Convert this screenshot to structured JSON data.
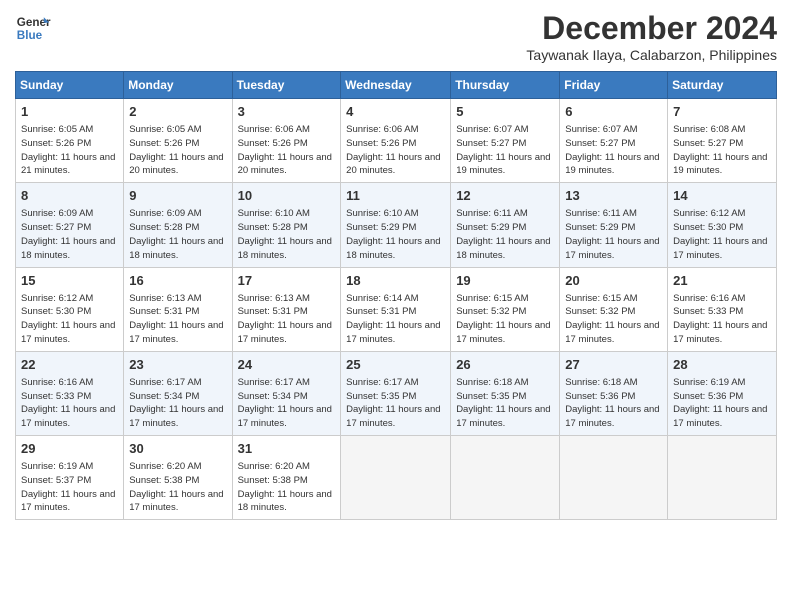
{
  "logo": {
    "line1": "General",
    "line2": "Blue"
  },
  "title": "December 2024",
  "subtitle": "Taywanak Ilaya, Calabarzon, Philippines",
  "headers": [
    "Sunday",
    "Monday",
    "Tuesday",
    "Wednesday",
    "Thursday",
    "Friday",
    "Saturday"
  ],
  "weeks": [
    [
      {
        "day": "1",
        "sunrise": "Sunrise: 6:05 AM",
        "sunset": "Sunset: 5:26 PM",
        "daylight": "Daylight: 11 hours and 21 minutes."
      },
      {
        "day": "2",
        "sunrise": "Sunrise: 6:05 AM",
        "sunset": "Sunset: 5:26 PM",
        "daylight": "Daylight: 11 hours and 20 minutes."
      },
      {
        "day": "3",
        "sunrise": "Sunrise: 6:06 AM",
        "sunset": "Sunset: 5:26 PM",
        "daylight": "Daylight: 11 hours and 20 minutes."
      },
      {
        "day": "4",
        "sunrise": "Sunrise: 6:06 AM",
        "sunset": "Sunset: 5:26 PM",
        "daylight": "Daylight: 11 hours and 20 minutes."
      },
      {
        "day": "5",
        "sunrise": "Sunrise: 6:07 AM",
        "sunset": "Sunset: 5:27 PM",
        "daylight": "Daylight: 11 hours and 19 minutes."
      },
      {
        "day": "6",
        "sunrise": "Sunrise: 6:07 AM",
        "sunset": "Sunset: 5:27 PM",
        "daylight": "Daylight: 11 hours and 19 minutes."
      },
      {
        "day": "7",
        "sunrise": "Sunrise: 6:08 AM",
        "sunset": "Sunset: 5:27 PM",
        "daylight": "Daylight: 11 hours and 19 minutes."
      }
    ],
    [
      {
        "day": "8",
        "sunrise": "Sunrise: 6:09 AM",
        "sunset": "Sunset: 5:27 PM",
        "daylight": "Daylight: 11 hours and 18 minutes."
      },
      {
        "day": "9",
        "sunrise": "Sunrise: 6:09 AM",
        "sunset": "Sunset: 5:28 PM",
        "daylight": "Daylight: 11 hours and 18 minutes."
      },
      {
        "day": "10",
        "sunrise": "Sunrise: 6:10 AM",
        "sunset": "Sunset: 5:28 PM",
        "daylight": "Daylight: 11 hours and 18 minutes."
      },
      {
        "day": "11",
        "sunrise": "Sunrise: 6:10 AM",
        "sunset": "Sunset: 5:29 PM",
        "daylight": "Daylight: 11 hours and 18 minutes."
      },
      {
        "day": "12",
        "sunrise": "Sunrise: 6:11 AM",
        "sunset": "Sunset: 5:29 PM",
        "daylight": "Daylight: 11 hours and 18 minutes."
      },
      {
        "day": "13",
        "sunrise": "Sunrise: 6:11 AM",
        "sunset": "Sunset: 5:29 PM",
        "daylight": "Daylight: 11 hours and 17 minutes."
      },
      {
        "day": "14",
        "sunrise": "Sunrise: 6:12 AM",
        "sunset": "Sunset: 5:30 PM",
        "daylight": "Daylight: 11 hours and 17 minutes."
      }
    ],
    [
      {
        "day": "15",
        "sunrise": "Sunrise: 6:12 AM",
        "sunset": "Sunset: 5:30 PM",
        "daylight": "Daylight: 11 hours and 17 minutes."
      },
      {
        "day": "16",
        "sunrise": "Sunrise: 6:13 AM",
        "sunset": "Sunset: 5:31 PM",
        "daylight": "Daylight: 11 hours and 17 minutes."
      },
      {
        "day": "17",
        "sunrise": "Sunrise: 6:13 AM",
        "sunset": "Sunset: 5:31 PM",
        "daylight": "Daylight: 11 hours and 17 minutes."
      },
      {
        "day": "18",
        "sunrise": "Sunrise: 6:14 AM",
        "sunset": "Sunset: 5:31 PM",
        "daylight": "Daylight: 11 hours and 17 minutes."
      },
      {
        "day": "19",
        "sunrise": "Sunrise: 6:15 AM",
        "sunset": "Sunset: 5:32 PM",
        "daylight": "Daylight: 11 hours and 17 minutes."
      },
      {
        "day": "20",
        "sunrise": "Sunrise: 6:15 AM",
        "sunset": "Sunset: 5:32 PM",
        "daylight": "Daylight: 11 hours and 17 minutes."
      },
      {
        "day": "21",
        "sunrise": "Sunrise: 6:16 AM",
        "sunset": "Sunset: 5:33 PM",
        "daylight": "Daylight: 11 hours and 17 minutes."
      }
    ],
    [
      {
        "day": "22",
        "sunrise": "Sunrise: 6:16 AM",
        "sunset": "Sunset: 5:33 PM",
        "daylight": "Daylight: 11 hours and 17 minutes."
      },
      {
        "day": "23",
        "sunrise": "Sunrise: 6:17 AM",
        "sunset": "Sunset: 5:34 PM",
        "daylight": "Daylight: 11 hours and 17 minutes."
      },
      {
        "day": "24",
        "sunrise": "Sunrise: 6:17 AM",
        "sunset": "Sunset: 5:34 PM",
        "daylight": "Daylight: 11 hours and 17 minutes."
      },
      {
        "day": "25",
        "sunrise": "Sunrise: 6:17 AM",
        "sunset": "Sunset: 5:35 PM",
        "daylight": "Daylight: 11 hours and 17 minutes."
      },
      {
        "day": "26",
        "sunrise": "Sunrise: 6:18 AM",
        "sunset": "Sunset: 5:35 PM",
        "daylight": "Daylight: 11 hours and 17 minutes."
      },
      {
        "day": "27",
        "sunrise": "Sunrise: 6:18 AM",
        "sunset": "Sunset: 5:36 PM",
        "daylight": "Daylight: 11 hours and 17 minutes."
      },
      {
        "day": "28",
        "sunrise": "Sunrise: 6:19 AM",
        "sunset": "Sunset: 5:36 PM",
        "daylight": "Daylight: 11 hours and 17 minutes."
      }
    ],
    [
      {
        "day": "29",
        "sunrise": "Sunrise: 6:19 AM",
        "sunset": "Sunset: 5:37 PM",
        "daylight": "Daylight: 11 hours and 17 minutes."
      },
      {
        "day": "30",
        "sunrise": "Sunrise: 6:20 AM",
        "sunset": "Sunset: 5:38 PM",
        "daylight": "Daylight: 11 hours and 17 minutes."
      },
      {
        "day": "31",
        "sunrise": "Sunrise: 6:20 AM",
        "sunset": "Sunset: 5:38 PM",
        "daylight": "Daylight: 11 hours and 18 minutes."
      },
      null,
      null,
      null,
      null
    ]
  ]
}
